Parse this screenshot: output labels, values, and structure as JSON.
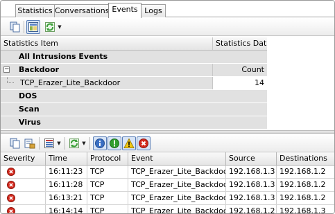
{
  "tabs": [
    "Statistics",
    "Conversations",
    "Events",
    "Logs"
  ],
  "active_tab": "Events",
  "stats": {
    "columns": [
      "Statistics Item",
      "Statistics Data"
    ],
    "rows": [
      {
        "label": "All Intrusions Events"
      },
      {
        "label": "Backdoor",
        "data": "Count"
      },
      {
        "label": "TCP_Erazer_Lite_Backdoor",
        "data": "14"
      },
      {
        "label": "DOS"
      },
      {
        "label": "Scan"
      },
      {
        "label": "Virus"
      }
    ],
    "collapse_glyph": "−"
  },
  "toolbar_icons": {
    "top": [
      "copy-icon",
      "view-icon",
      "refresh-icon",
      "dropdown-arrow"
    ],
    "bottom": [
      "copy-icon",
      "export-icon",
      "filter-list-icon",
      "dropdown-arrow",
      "refresh-icon",
      "dropdown-arrow",
      "info-icon",
      "notice-icon",
      "warning-icon",
      "error-icon"
    ]
  },
  "events": {
    "columns": [
      "Severity",
      "Time",
      "Protocol",
      "Event",
      "Source",
      "Destinations"
    ],
    "rows": [
      {
        "severity": "error",
        "time": "16:11:23",
        "protocol": "TCP",
        "event": "TCP_Erazer_Lite_Backdoor",
        "source": "192.168.1.3",
        "destination": "192.168.1.2"
      },
      {
        "severity": "error",
        "time": "16:11:28",
        "protocol": "TCP",
        "event": "TCP_Erazer_Lite_Backdoor",
        "source": "192.168.1.3",
        "destination": "192.168.1.2"
      },
      {
        "severity": "error",
        "time": "16:13:21",
        "protocol": "TCP",
        "event": "TCP_Erazer_Lite_Backdoor",
        "source": "192.168.1.3",
        "destination": "192.168.1.2"
      },
      {
        "severity": "error",
        "time": "16:14:14",
        "protocol": "TCP",
        "event": "TCP_Erazer_Lite_Backdoor",
        "source": "192.168.1.2",
        "destination": "192.168.1.3"
      }
    ]
  },
  "colors": {
    "error": "#d42a1e",
    "warning": "#f2c811",
    "notice": "#2f9e2f",
    "info": "#3a6fc4",
    "refresh": "#3aa038"
  }
}
